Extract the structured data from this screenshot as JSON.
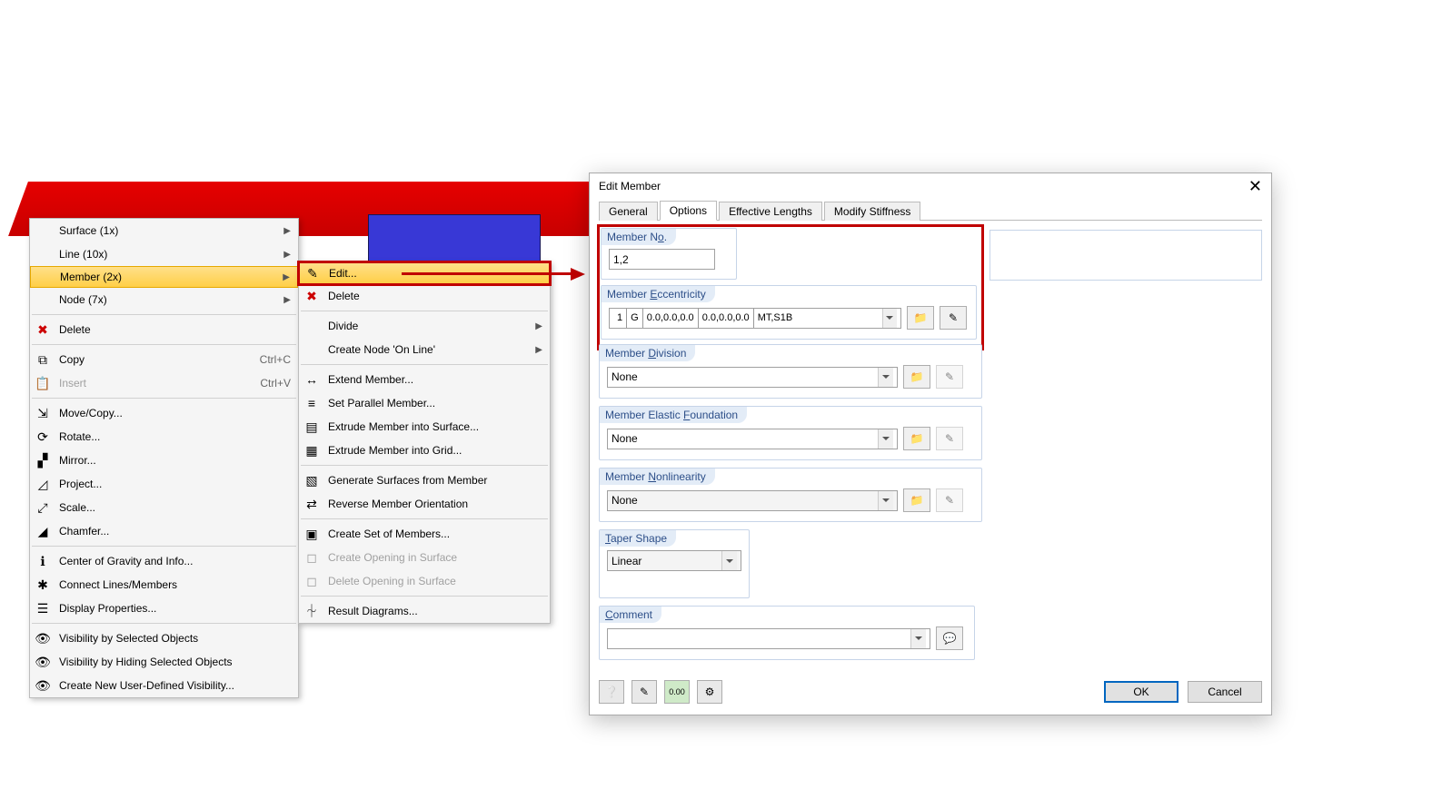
{
  "context_menu": {
    "main": [
      {
        "label": "Surface (1x)",
        "has_sub": true
      },
      {
        "label": "Line (10x)",
        "has_sub": true
      },
      {
        "label": "Member (2x)",
        "has_sub": true,
        "highlight": true
      },
      {
        "label": "Node (7x)",
        "has_sub": true
      }
    ],
    "delete": "Delete",
    "copy": {
      "label": "Copy",
      "key": "Ctrl+C"
    },
    "insert": {
      "label": "Insert",
      "key": "Ctrl+V"
    },
    "edit_group": [
      "Move/Copy...",
      "Rotate...",
      "Mirror...",
      "Project...",
      "Scale...",
      "Chamfer..."
    ],
    "info_group": [
      "Center of Gravity and Info...",
      "Connect Lines/Members",
      "Display Properties..."
    ],
    "vis_group": [
      "Visibility by Selected Objects",
      "Visibility by Hiding Selected Objects",
      "Create New User-Defined Visibility..."
    ]
  },
  "submenu": {
    "edit": "Edit...",
    "delete": "Delete",
    "divide": "Divide",
    "create_node": "Create Node 'On Line'",
    "extend": "Extend Member...",
    "set_parallel": "Set Parallel Member...",
    "extrude_surf": "Extrude Member into Surface...",
    "extrude_grid": "Extrude Member into Grid...",
    "gen_surf": "Generate Surfaces from Member",
    "rev_orient": "Reverse Member Orientation",
    "create_set": "Create Set of Members...",
    "create_open": "Create Opening in Surface",
    "delete_open": "Delete Opening in Surface",
    "result_diag": "Result Diagrams..."
  },
  "dialog": {
    "title": "Edit Member",
    "tabs": [
      "General",
      "Options",
      "Effective Lengths",
      "Modify Stiffness"
    ],
    "active_tab": "Options",
    "member_no": {
      "legend_pre": "Member N",
      "legend_ul": "o",
      "legend_post": ".",
      "value": "1,2"
    },
    "eccentricity": {
      "legend_pre": "Member ",
      "legend_ul": "E",
      "legend_post": "ccentricity",
      "cells": [
        "1",
        "G",
        "0.0,0.0,0.0",
        "0.0,0.0,0.0",
        "MT,S1B"
      ]
    },
    "division": {
      "legend_pre": "Member ",
      "legend_ul": "D",
      "legend_post": "ivision",
      "value": "None"
    },
    "foundation": {
      "legend_pre": "Member Elastic ",
      "legend_ul": "F",
      "legend_post": "oundation",
      "value": "None"
    },
    "nonlin": {
      "legend_pre": "Member ",
      "legend_ul": "N",
      "legend_post": "onlinearity",
      "value": "None"
    },
    "taper": {
      "legend_ul": "T",
      "legend_post": "aper Shape",
      "value": "Linear"
    },
    "comment": {
      "legend_ul": "C",
      "legend_post": "omment",
      "value": ""
    },
    "buttons": {
      "ok": "OK",
      "cancel": "Cancel"
    }
  }
}
